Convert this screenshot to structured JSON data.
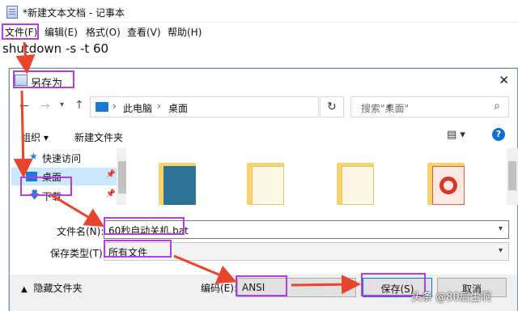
{
  "notepad": {
    "title": "*新建文本文档 - 记事本",
    "menu": [
      "文件(F)",
      "编辑(E)",
      "格式(O)",
      "查看(V)",
      "帮助(H)"
    ],
    "content": "shutdown -s -t 60"
  },
  "dialog": {
    "title": "另存为",
    "close": "✕",
    "breadcrumb": [
      "此电脑",
      "桌面"
    ],
    "search_placeholder": "搜索\"桌面\"",
    "organize_label": "组织 ▾",
    "new_folder_label": "新建文件夹",
    "sidebar": [
      {
        "label": "快速访问",
        "icon": "star-icon"
      },
      {
        "label": "桌面",
        "icon": "desktop-icon"
      },
      {
        "label": "下载",
        "icon": "download-icon"
      }
    ],
    "file_name_label": "文件名(N):",
    "file_name_value": "60秒自动关机.bat",
    "file_type_label": "保存类型(T):",
    "file_type_value": "所有文件",
    "hide_folders_label": "隐藏文件夹",
    "encoding_label": "编码(E):",
    "encoding_value": "ANSI",
    "save_label": "保存(S)",
    "cancel_label": "取消"
  },
  "watermark": "头条 @80后生啊",
  "colors": {
    "highlight": "#b23fe0",
    "arrow": "#e9442c",
    "selection": "#cce8ff",
    "accent": "#0078d7"
  }
}
